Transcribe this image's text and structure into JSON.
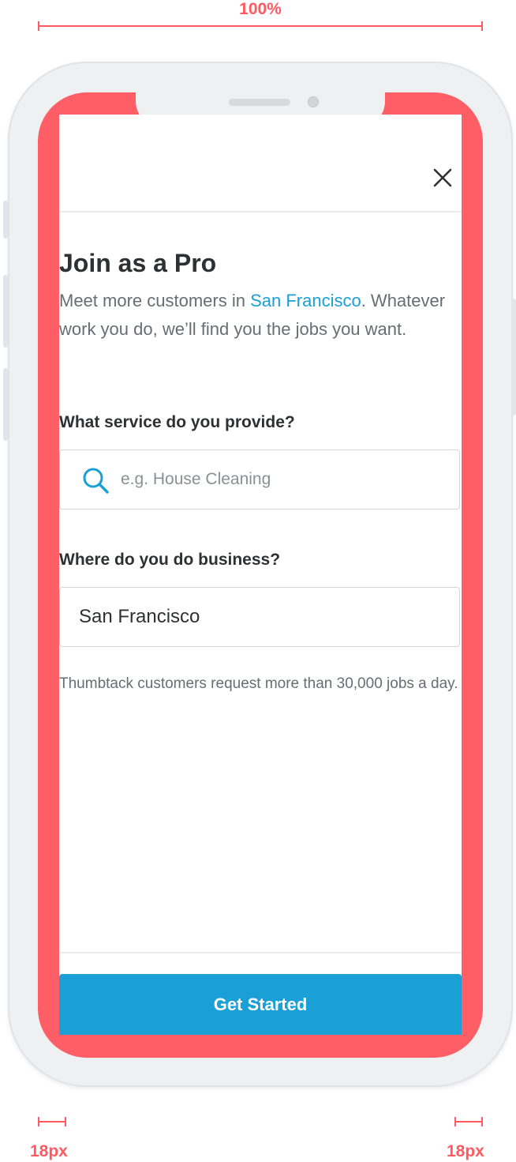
{
  "annotations": {
    "width_label": "100%",
    "left_margin_label": "18px",
    "right_margin_label": "18px"
  },
  "colors": {
    "accent": "#1a9fd6",
    "annotation": "#ff5a63",
    "heading": "#2f3033",
    "body_text": "#676d73"
  },
  "header": {
    "close_icon": "close-icon"
  },
  "content": {
    "title": "Join as a Pro",
    "intro_prefix": "Meet more customers in ",
    "intro_city": "San Francisco",
    "intro_suffix": ". Whatever work you do, we’ll find you the jobs you want.",
    "service_label": "What service do you provide?",
    "service_placeholder": "e.g. House Cleaning",
    "service_value": "",
    "service_icon": "search-icon",
    "location_label": "Where do you do business?",
    "location_value": "San Francisco",
    "note": "Thumbtack customers request more than 30,000 jobs a day."
  },
  "footer": {
    "cta_label": "Get Started"
  }
}
